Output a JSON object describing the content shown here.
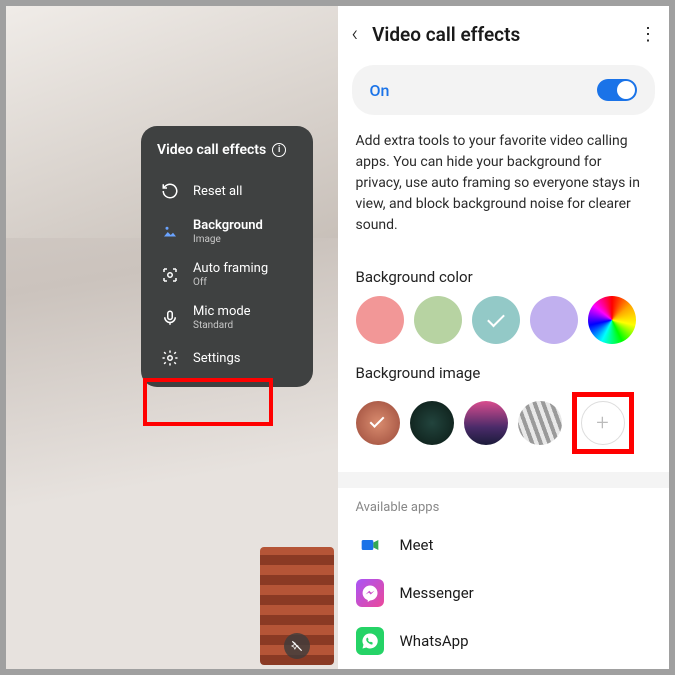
{
  "left": {
    "panel_title": "Video call effects",
    "items": [
      {
        "label": "Reset all",
        "sub": ""
      },
      {
        "label": "Background",
        "sub": "Image"
      },
      {
        "label": "Auto framing",
        "sub": "Off"
      },
      {
        "label": "Mic mode",
        "sub": "Standard"
      },
      {
        "label": "Settings",
        "sub": ""
      }
    ]
  },
  "right": {
    "title": "Video call effects",
    "toggle_label": "On",
    "toggle_state": true,
    "description": "Add extra tools to your favorite video calling apps. You can hide your background for privacy, use auto framing so everyone stays in view, and block background noise for clearer sound.",
    "bg_color_label": "Background color",
    "colors": [
      {
        "hex": "#f29797",
        "selected": false
      },
      {
        "hex": "#b7d3a2",
        "selected": false
      },
      {
        "hex": "#93c9c7",
        "selected": true
      },
      {
        "hex": "#c1b0ef",
        "selected": false
      },
      {
        "hex": "conic-gradient(red,orange,yellow,lime,cyan,blue,magenta,red)",
        "selected": false
      }
    ],
    "bg_image_label": "Background image",
    "images": [
      {
        "bg": "radial-gradient(circle,#d98c6f,#9b4a3a)",
        "selected": true
      },
      {
        "bg": "radial-gradient(circle,#22443d,#0b1a15)",
        "selected": false
      },
      {
        "bg": "linear-gradient(180deg,#d94c8e 0%,#4a2b69 60%,#1b1b3a 100%)",
        "selected": false
      },
      {
        "bg": "repeating-linear-gradient(70deg,#e8e8e8 0 4px,#9a9a9a 4px 8px)",
        "selected": false
      }
    ],
    "available_label": "Available apps",
    "apps": [
      {
        "name": "Meet",
        "icon_bg": "#fff",
        "icon_fg": "#1a73e8"
      },
      {
        "name": "Messenger",
        "icon_bg": "linear-gradient(135deg,#a855f7,#ec4899)",
        "icon_fg": "#fff"
      },
      {
        "name": "WhatsApp",
        "icon_bg": "#25d366",
        "icon_fg": "#fff"
      }
    ]
  }
}
